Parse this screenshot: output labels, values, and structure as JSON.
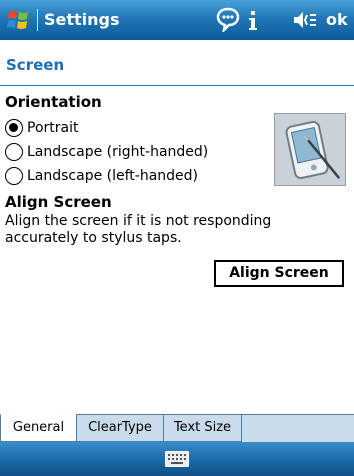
{
  "titlebar": {
    "title": "Settings",
    "ok_label": "ok",
    "icons": [
      "windows-start-icon",
      "message-bubble-icon",
      "signal-icon",
      "speaker-icon"
    ]
  },
  "page": {
    "title": "Screen"
  },
  "orientation": {
    "heading": "Orientation",
    "options": [
      {
        "label": "Portrait",
        "selected": true
      },
      {
        "label": "Landscape (right-handed)",
        "selected": false
      },
      {
        "label": "Landscape (left-handed)",
        "selected": false
      }
    ]
  },
  "align": {
    "heading": "Align Screen",
    "description": "Align the screen if it is not responding accurately to stylus taps.",
    "button_label": "Align Screen"
  },
  "tabs": [
    {
      "label": "General",
      "active": true
    },
    {
      "label": "ClearType",
      "active": false
    },
    {
      "label": "Text Size",
      "active": false
    }
  ],
  "menubar": {
    "icon": "keyboard-icon"
  },
  "colors": {
    "accent": "#1d6fb2",
    "titlebar": "#1f77b7",
    "tabbar": "#c9dcec"
  }
}
